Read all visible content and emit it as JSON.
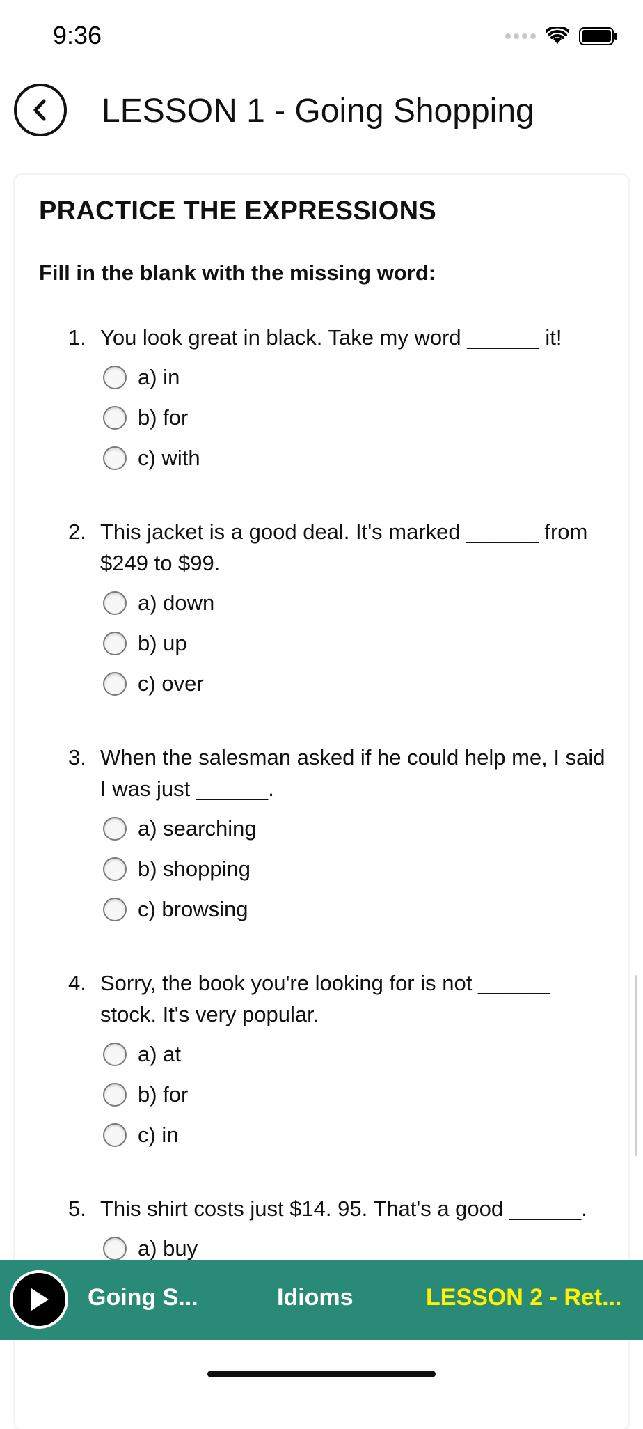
{
  "status_bar": {
    "time": "9:36",
    "icons": [
      "signal-dots-icon",
      "wifi-icon",
      "battery-icon"
    ]
  },
  "header": {
    "title": "LESSON 1 - Going Shopping",
    "back_icon": "chevron-left-icon"
  },
  "card": {
    "section_title": "PRACTICE THE EXPRESSIONS",
    "instruction": "Fill in the blank with the missing word:",
    "questions": [
      {
        "number": "1.",
        "text": "You look great in black. Take my word ______ it!",
        "options": [
          "a) in",
          "b) for",
          "c) with"
        ]
      },
      {
        "number": "2.",
        "text": "This jacket is a good deal. It's marked ______ from $249 to $99.",
        "options": [
          "a) down",
          "b) up",
          "c) over"
        ]
      },
      {
        "number": "3.",
        "text": "When the salesman asked if he could help me, I said I was just ______.",
        "options": [
          "a) searching",
          "b) shopping",
          "c) browsing"
        ]
      },
      {
        "number": "4.",
        "text": "Sorry, the book you're looking for is not ______ stock. It's very popular.",
        "options": [
          "a) at",
          "b) for",
          "c) in"
        ]
      },
      {
        "number": "5.",
        "text": "This shirt costs just $14. 95. That's a good ______.",
        "options": [
          "a) buy"
        ]
      }
    ]
  },
  "tab_bar": {
    "background": "#2a8a78",
    "active_color": "#fff200",
    "play_icon": "play-icon",
    "tabs": [
      "Going S...",
      "Idioms",
      "LESSON 2 - Ret..."
    ]
  }
}
